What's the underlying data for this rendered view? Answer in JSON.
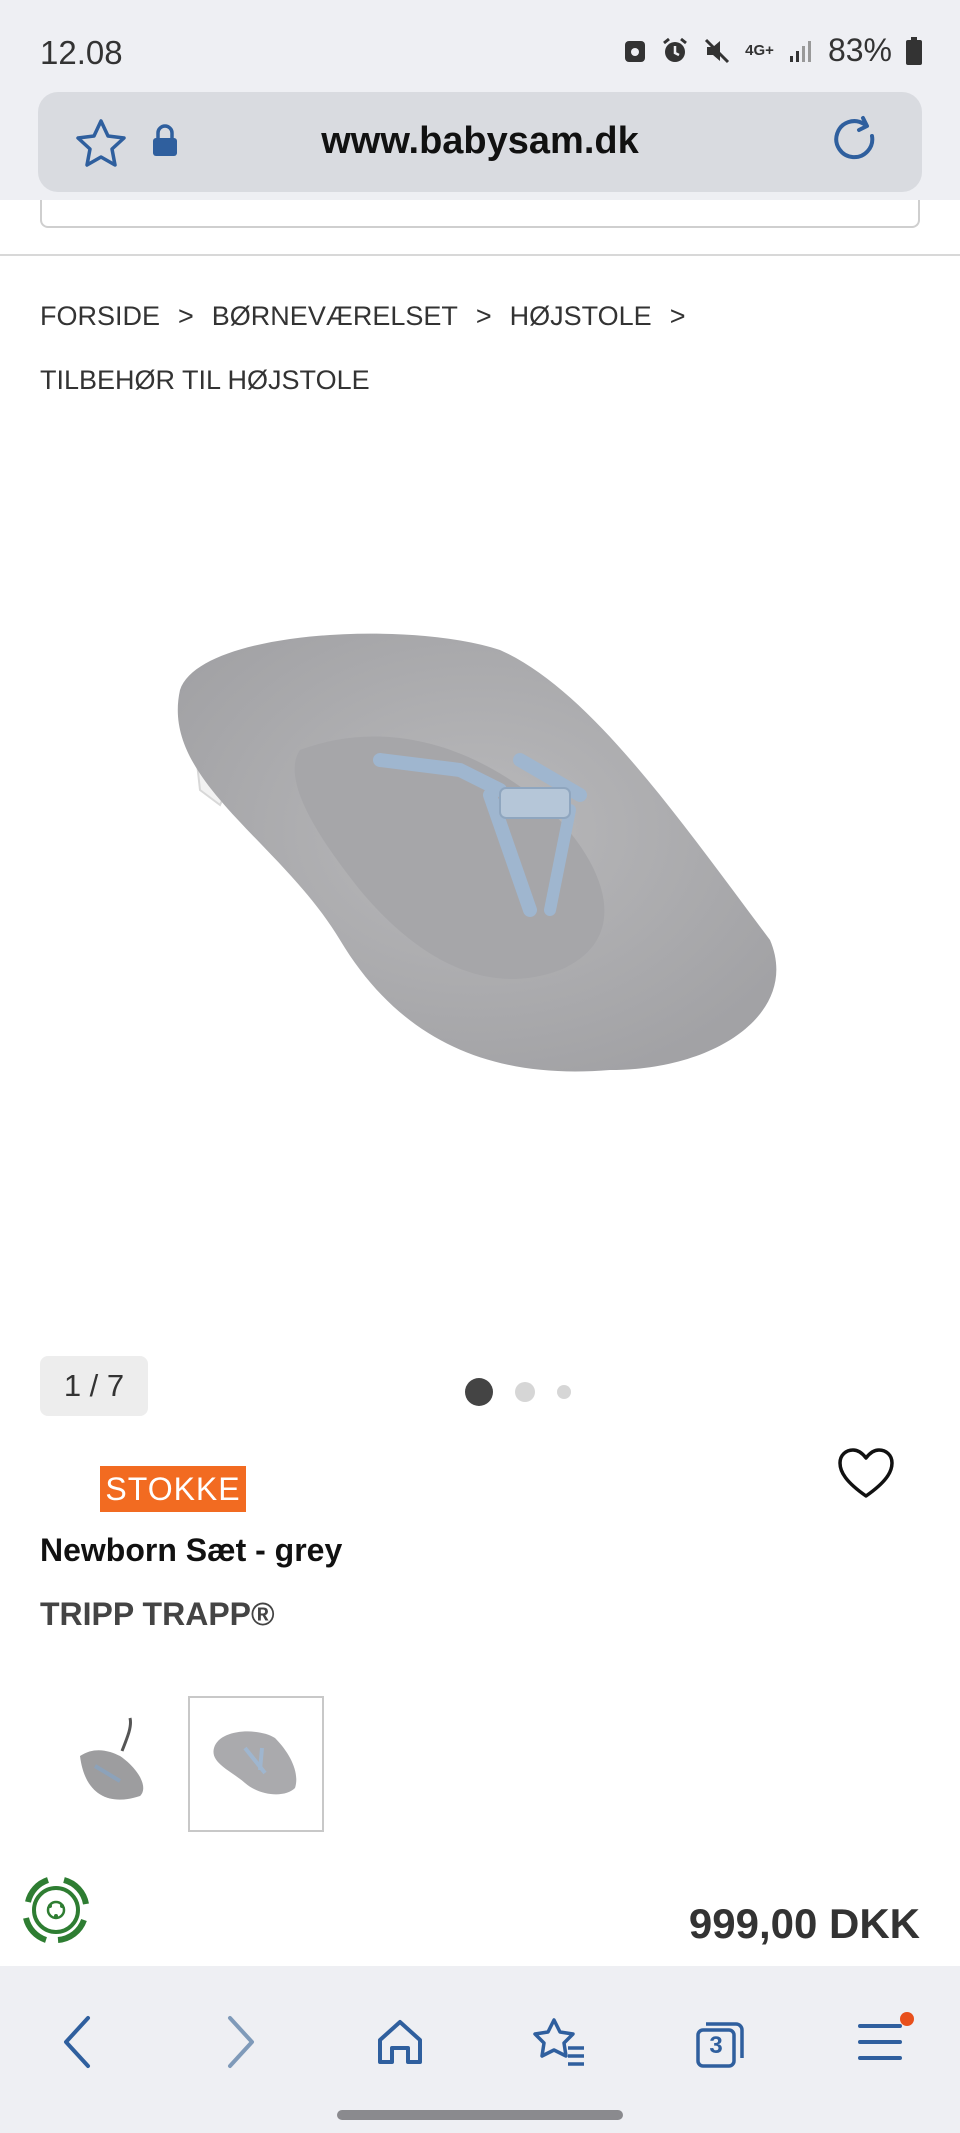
{
  "status_bar": {
    "time": "12.08",
    "battery": "83%",
    "network": "4G+"
  },
  "browser": {
    "url": "www.babysam.dk",
    "tab_count": "3"
  },
  "breadcrumb": {
    "items": [
      "FORSIDE",
      "BØRNEVÆRELSET",
      "HØJSTOLE",
      "TILBEHØR TIL HØJSTOLE"
    ],
    "separator": ">"
  },
  "gallery": {
    "counter": "1 / 7",
    "dot_count": 3,
    "active_dot": 0
  },
  "product": {
    "brand": "STOKKE",
    "title": "Newborn Sæt - grey",
    "subtitle": "TRIPP TRAPP®",
    "price": "999,00 DKK"
  },
  "colors": {
    "accent_blue": "#2f5f9e",
    "brand_orange": "#f26b21",
    "eco_green": "#2e7d32",
    "notification_dot": "#e8501c"
  }
}
